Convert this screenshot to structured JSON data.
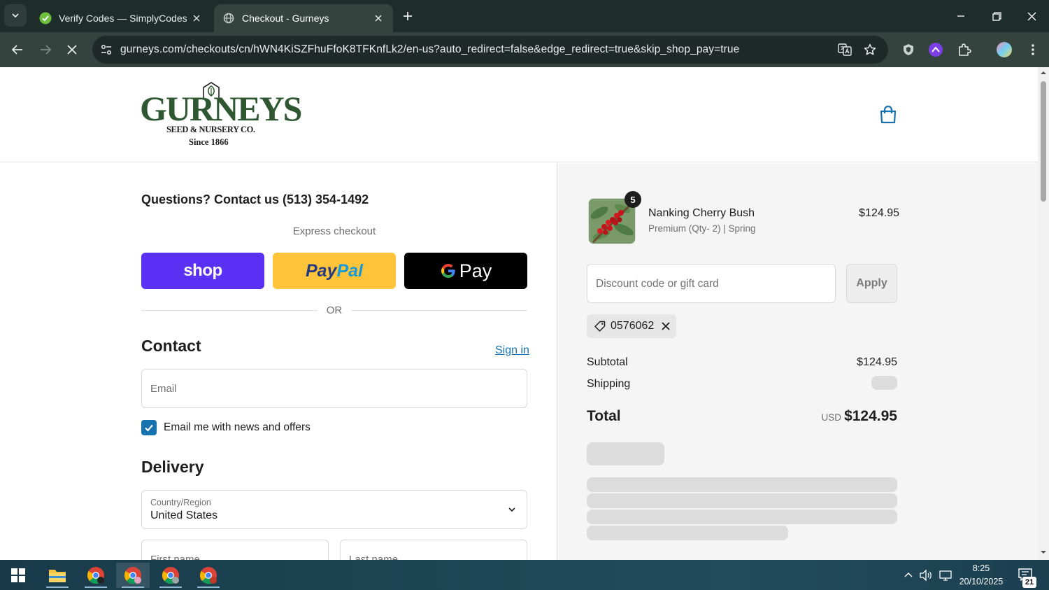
{
  "browser": {
    "tabs": [
      {
        "title": "Verify Codes — SimplyCodes",
        "favicon": "simplycodes-icon",
        "active": false
      },
      {
        "title": "Checkout - Gurneys",
        "favicon": "loading-globe-icon",
        "active": true
      }
    ],
    "url": "gurneys.com/checkouts/cn/hWN4KiSZFhuFfoK8TFKnfLk2/en-us?auto_redirect=false&edge_redirect=true&skip_shop_pay=true"
  },
  "header": {
    "logo_main": "GURNEYS",
    "logo_sub": "SEED & NURSERY CO.",
    "logo_since": "Since 1866"
  },
  "checkout": {
    "questions": "Questions? Contact us (513) 354-1492",
    "express_label": "Express checkout",
    "shop_label": "shop",
    "paypal_part1": "Pay",
    "paypal_part2": "Pal",
    "gpay_label": "Pay",
    "or_label": "OR",
    "contact_title": "Contact",
    "signin_label": "Sign in",
    "email_placeholder": "Email",
    "news_label": "Email me with news and offers",
    "news_checked": true,
    "delivery_title": "Delivery",
    "country_label": "Country/Region",
    "country_value": "United States",
    "first_name_placeholder": "First name",
    "last_name_placeholder": "Last name"
  },
  "summary": {
    "product_name": "Nanking Cherry Bush",
    "product_variant": "Premium (Qty- 2) | Spring",
    "product_price": "$124.95",
    "quantity": "5",
    "discount_placeholder": "Discount code or gift card",
    "apply_label": "Apply",
    "applied_code": "0576062",
    "subtotal_label": "Subtotal",
    "subtotal_value": "$124.95",
    "shipping_label": "Shipping",
    "total_label": "Total",
    "total_currency": "USD",
    "total_value": "$124.95"
  },
  "taskbar": {
    "time": "8:25",
    "date": "20/10/2025",
    "notifications": "21"
  },
  "colors": {
    "shop": "#5a31f4",
    "paypal": "#ffc439",
    "link": "#1773b0",
    "logo_green": "#2f5732"
  }
}
